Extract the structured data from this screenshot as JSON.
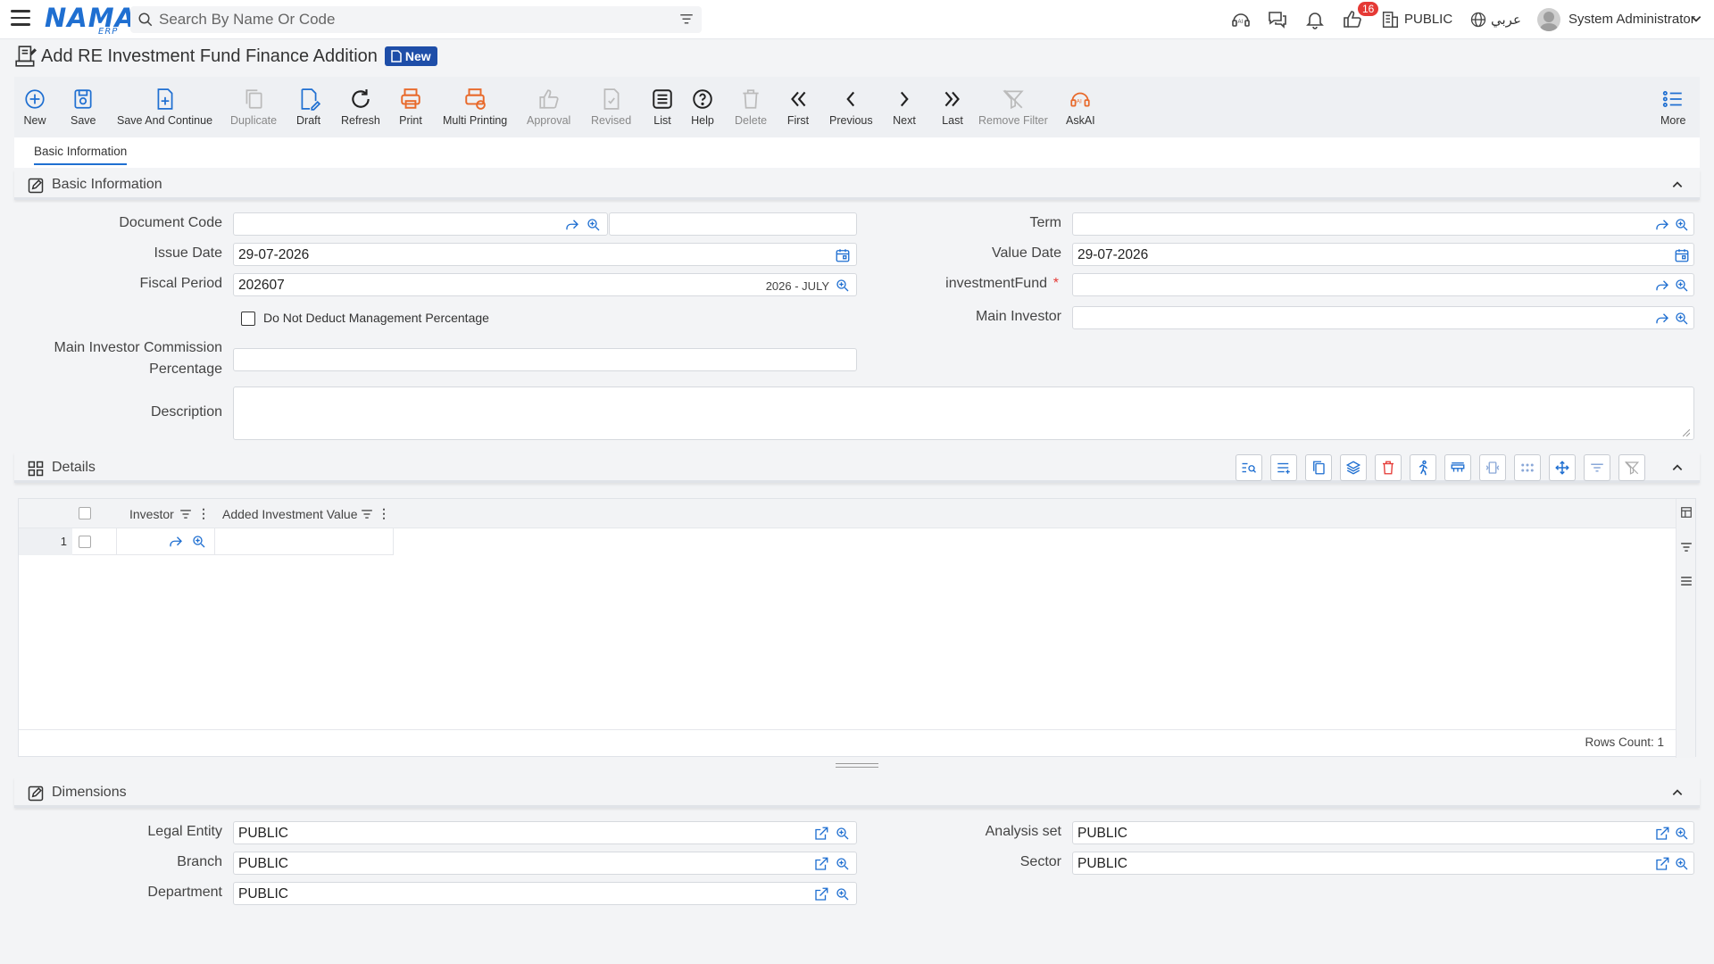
{
  "topbar": {
    "search_placeholder": "Search By Name Or Code",
    "notification_count": "16",
    "company": "PUBLIC",
    "language": "عربي",
    "user": "System Administrator",
    "logo_text": "NAMA",
    "logo_sub": "ERP"
  },
  "page": {
    "title": "Add RE Investment Fund Finance Addition",
    "status_badge": "New"
  },
  "toolbar": {
    "new": "New",
    "save": "Save",
    "save_continue": "Save And Continue",
    "duplicate": "Duplicate",
    "draft": "Draft",
    "refresh": "Refresh",
    "print": "Print",
    "multi_printing": "Multi Printing",
    "approval": "Approval",
    "revised": "Revised",
    "list": "List",
    "help": "Help",
    "delete": "Delete",
    "first": "First",
    "previous": "Previous",
    "next": "Next",
    "last": "Last",
    "remove_filter": "Remove Filter",
    "askai": "AskAI",
    "more": "More"
  },
  "tabs": {
    "basic_information": "Basic Information"
  },
  "basic_info": {
    "section_title": "Basic Information",
    "document_code_label": "Document Code",
    "document_code_value": "",
    "issue_date_label": "Issue Date",
    "issue_date_value": "29-07-2026",
    "fiscal_period_label": "Fiscal Period",
    "fiscal_period_value": "202607",
    "fiscal_period_name": "2026 - JULY",
    "no_deduct_label": "Do Not Deduct Management Percentage",
    "commission_label_1": "Main Investor Commission",
    "commission_label_2": "Percentage",
    "description_label": "Description",
    "term_label": "Term",
    "value_date_label": "Value Date",
    "value_date_value": "29-07-2026",
    "investment_fund_label": "investmentFund",
    "required_mark": "*",
    "main_investor_label": "Main Investor"
  },
  "details": {
    "section_title": "Details",
    "columns": [
      "Investor",
      "Added Investment Value"
    ],
    "rows": [
      {
        "index": "1"
      }
    ],
    "rows_count": "Rows Count: 1"
  },
  "dimensions": {
    "section_title": "Dimensions",
    "legal_entity_label": "Legal Entity",
    "legal_entity_value": "PUBLIC",
    "branch_label": "Branch",
    "branch_value": "PUBLIC",
    "department_label": "Department",
    "department_value": "PUBLIC",
    "analysis_set_label": "Analysis set",
    "analysis_set_value": "PUBLIC",
    "sector_label": "Sector",
    "sector_value": "PUBLIC"
  },
  "colors": {
    "accent": "#1f6fd1",
    "badge_bg": "#1e4ea8",
    "print_orange": "#e8692a",
    "danger": "#e53935"
  }
}
